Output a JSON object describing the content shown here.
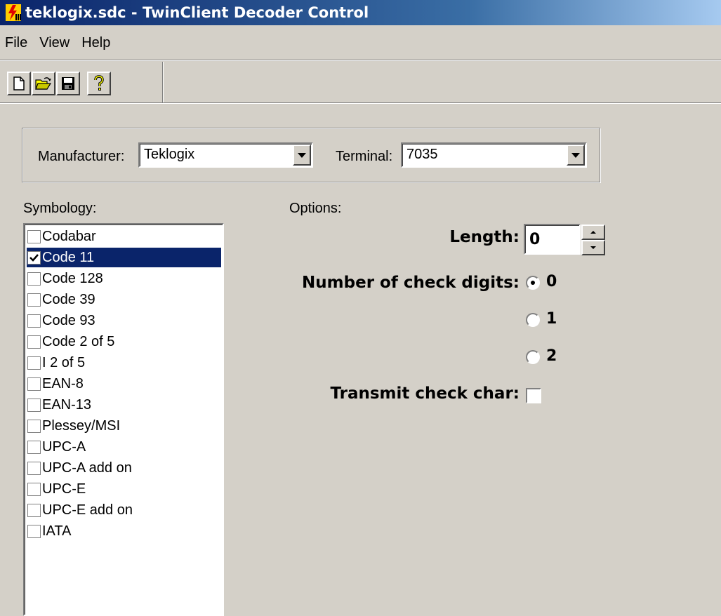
{
  "window": {
    "title": "teklogix.sdc - TwinClient Decoder Control"
  },
  "menu": {
    "file": "File",
    "view": "View",
    "help": "Help"
  },
  "toolbar": {
    "icons": [
      "new-file-icon",
      "open-folder-icon",
      "save-disk-icon",
      "help-question-icon"
    ],
    "help_glyph": "?"
  },
  "filters": {
    "manufacturer_label": "Manufacturer:",
    "manufacturer_value": "Teklogix",
    "terminal_label": "Terminal:",
    "terminal_value": "7035"
  },
  "symbology": {
    "label": "Symbology:",
    "items": [
      {
        "label": "Codabar",
        "checked": false,
        "selected": false
      },
      {
        "label": "Code 11",
        "checked": true,
        "selected": true
      },
      {
        "label": "Code 128",
        "checked": false,
        "selected": false
      },
      {
        "label": "Code 39",
        "checked": false,
        "selected": false
      },
      {
        "label": "Code 93",
        "checked": false,
        "selected": false
      },
      {
        "label": "Code 2 of 5",
        "checked": false,
        "selected": false
      },
      {
        "label": "I 2 of 5",
        "checked": false,
        "selected": false
      },
      {
        "label": "EAN-8",
        "checked": false,
        "selected": false
      },
      {
        "label": "EAN-13",
        "checked": false,
        "selected": false
      },
      {
        "label": "Plessey/MSI",
        "checked": false,
        "selected": false
      },
      {
        "label": "UPC-A",
        "checked": false,
        "selected": false
      },
      {
        "label": "UPC-A add on",
        "checked": false,
        "selected": false
      },
      {
        "label": "UPC-E",
        "checked": false,
        "selected": false
      },
      {
        "label": "UPC-E add on",
        "checked": false,
        "selected": false
      },
      {
        "label": "IATA",
        "checked": false,
        "selected": false
      }
    ]
  },
  "options": {
    "label": "Options:",
    "length_label": "Length:",
    "length_value": "0",
    "check_digits_label": "Number of check digits:",
    "check_digits_options": [
      "0",
      "1",
      "2"
    ],
    "check_digits_selected": "0",
    "transmit_label": "Transmit check char:",
    "transmit_checked": false
  },
  "colors": {
    "selection": "#0a246a",
    "face": "#d4d0c8"
  }
}
